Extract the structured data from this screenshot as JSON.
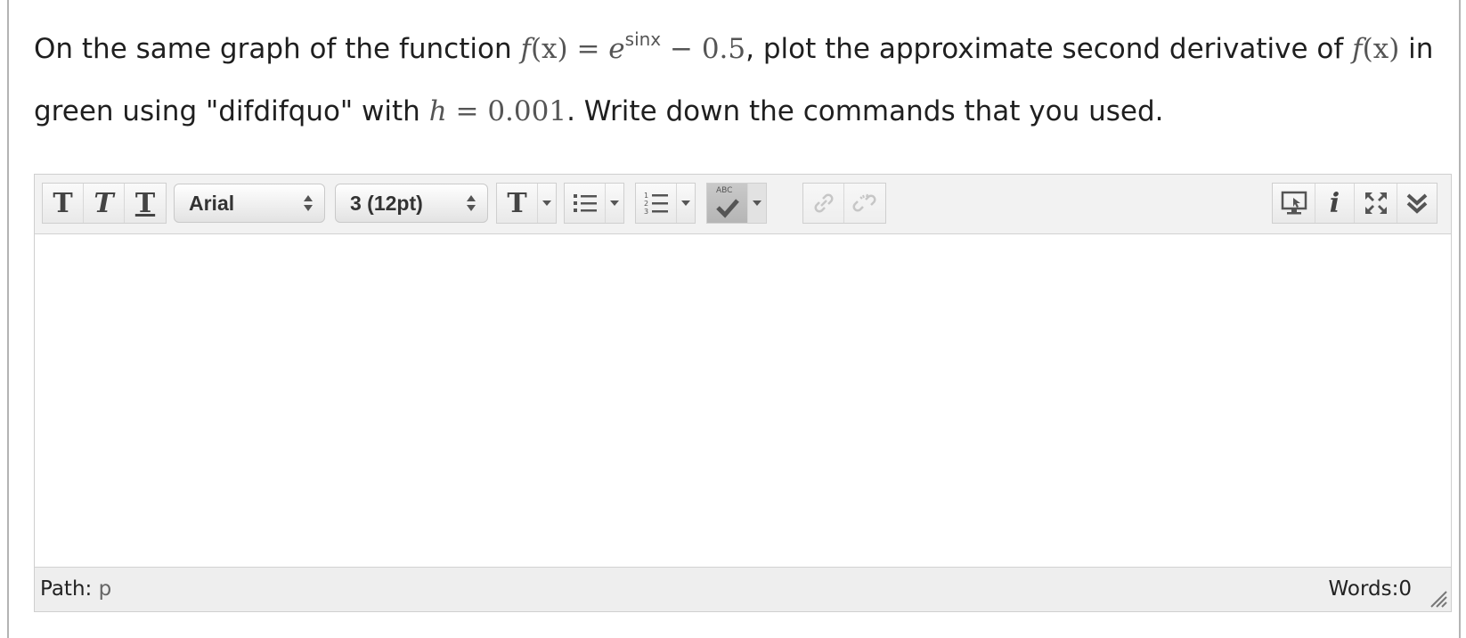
{
  "question": {
    "text_1": "On the same graph of the function ",
    "fx": "f",
    "paren_x": "(x)",
    "equals": " = ",
    "e": "e",
    "exponent": "sinx",
    "minus": " − 0.5",
    "text_2": ", plot the approximate second derivative of ",
    "fx2": "f",
    "paren_x2": "(x)",
    "text_3": " in green using \"difdifquo\" with ",
    "h": "h",
    "h_eq": " = 0.001",
    "text_4": ". Write down the commands that you used."
  },
  "toolbar": {
    "bold_glyph": "T",
    "italic_glyph": "T",
    "underline_glyph": "T",
    "font_family_value": "Arial",
    "font_size_value": "3 (12pt)",
    "text_color_glyph": "T",
    "spellcheck_label": "ABC"
  },
  "statusbar": {
    "path_label": "Path:",
    "path_value": "p",
    "words_label": "Words:0"
  },
  "colors": {
    "toolbar_bg": "#f2f2f2",
    "statusbar_bg": "#eeeeee",
    "border": "#cfcfcf"
  }
}
